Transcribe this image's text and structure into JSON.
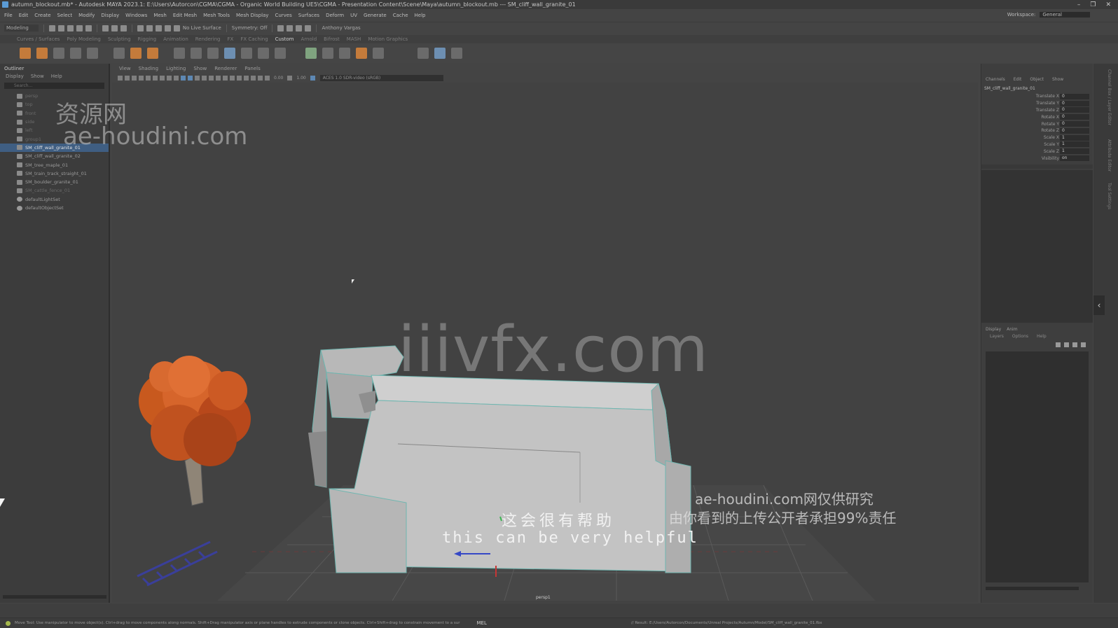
{
  "window": {
    "title": "autumn_blockout.mb* - Autodesk MAYA 2023.1: E:\\Users\\Autorcon\\CGMA\\CGMA - Organic World Building UE5\\CGMA - Presentation Content\\Scene\\Maya\\autumn_blockout.mb  ---  SM_cliff_wall_granite_01",
    "controls": [
      "–",
      "❐",
      "✕"
    ]
  },
  "menubar": {
    "items": [
      "File",
      "Edit",
      "Create",
      "Select",
      "Modify",
      "Display",
      "Windows",
      "Mesh",
      "Edit Mesh",
      "Mesh Tools",
      "Mesh Display",
      "Curves",
      "Surfaces",
      "Deform",
      "UV",
      "Generate",
      "Cache",
      "Help"
    ],
    "workspace_label": "Workspace:",
    "workspace_value": "General"
  },
  "statusline": {
    "mode": "Modeling",
    "no_live_surface": "No Live Surface",
    "symmetry": "Symmetry: Off",
    "user": "Anthony Vargas"
  },
  "shelf": {
    "tabs": [
      "Curves / Surfaces",
      "Poly Modeling",
      "Sculpting",
      "Rigging",
      "Animation",
      "Rendering",
      "FX",
      "FX Caching",
      "Custom",
      "Arnold",
      "Bifrost",
      "MASH",
      "Motion Graphics"
    ],
    "active_tab": "Custom"
  },
  "outliner": {
    "title": "Outliner",
    "menu": [
      "Display",
      "Show",
      "Help"
    ],
    "search_placeholder": "Search...",
    "items": [
      {
        "label": "persp",
        "state": "dim"
      },
      {
        "label": "top",
        "state": "dim"
      },
      {
        "label": "front",
        "state": "dim"
      },
      {
        "label": "side",
        "state": "dim"
      },
      {
        "label": "left",
        "state": "dim"
      },
      {
        "label": "group1",
        "state": "dim"
      },
      {
        "label": "SM_cliff_wall_granite_01",
        "state": "selected"
      },
      {
        "label": "SM_cliff_wall_granite_02",
        "state": "normal"
      },
      {
        "label": "SM_tree_maple_01",
        "state": "normal"
      },
      {
        "label": "SM_train_track_straight_01",
        "state": "normal"
      },
      {
        "label": "SM_boulder_granite_01",
        "state": "normal"
      },
      {
        "label": "SM_cattle_fence_01",
        "state": "dim"
      },
      {
        "label": "defaultLightSet",
        "state": "set"
      },
      {
        "label": "defaultObjectSet",
        "state": "set"
      }
    ]
  },
  "viewport": {
    "menu": [
      "View",
      "Shading",
      "Lighting",
      "Show",
      "Renderer",
      "Panels"
    ],
    "exposure": "0.00",
    "gamma": "1.00",
    "color_space": "ACES 1.0 SDR-video (sRGB)",
    "camera": "persp1"
  },
  "channel_box": {
    "tabs": [
      "Channels",
      "Edit",
      "Object",
      "Show"
    ],
    "object_name": "SM_cliff_wall_granite_01",
    "attributes": [
      {
        "name": "Translate X",
        "value": "0"
      },
      {
        "name": "Translate Y",
        "value": "0"
      },
      {
        "name": "Translate Z",
        "value": "0"
      },
      {
        "name": "Rotate X",
        "value": "0"
      },
      {
        "name": "Rotate Y",
        "value": "0"
      },
      {
        "name": "Rotate Z",
        "value": "0"
      },
      {
        "name": "Scale X",
        "value": "1"
      },
      {
        "name": "Scale Y",
        "value": "1"
      },
      {
        "name": "Scale Z",
        "value": "1"
      },
      {
        "name": "Visibility",
        "value": "on"
      }
    ],
    "layer_tabs": [
      "Display",
      "Anim"
    ],
    "layer_menu": [
      "Layers",
      "Options",
      "Help"
    ]
  },
  "right_strip": {
    "tabs": [
      "Channel Box / Layer Editor",
      "Attribute Editor",
      "Tool Settings"
    ]
  },
  "helpline": {
    "message": "Move Tool: Use manipulator to move object(s). Ctrl+drag to move components along normals. Shift+Drag manipulator axis or plane handles to extrude components or clone objects. Ctrl+Shift+drag to constrain movement to a sur",
    "mel_label": "MEL",
    "path": "// Result: E:/Users/Autorcon/Documents/Unreal Projects/Autumn/Model/SM_cliff_wall_granite_01.fbx"
  },
  "overlays": {
    "watermark_cn": "资源网",
    "watermark_url": "ae-houdini.com",
    "watermark_big": "iiivfx.com",
    "notice_line1": "ae-houdini.com网仅供研究",
    "notice_line2": "由你看到的上传公开者承担99%责任",
    "subtitle_cn": "这会很有帮助",
    "subtitle_en": "this can be very helpful"
  }
}
